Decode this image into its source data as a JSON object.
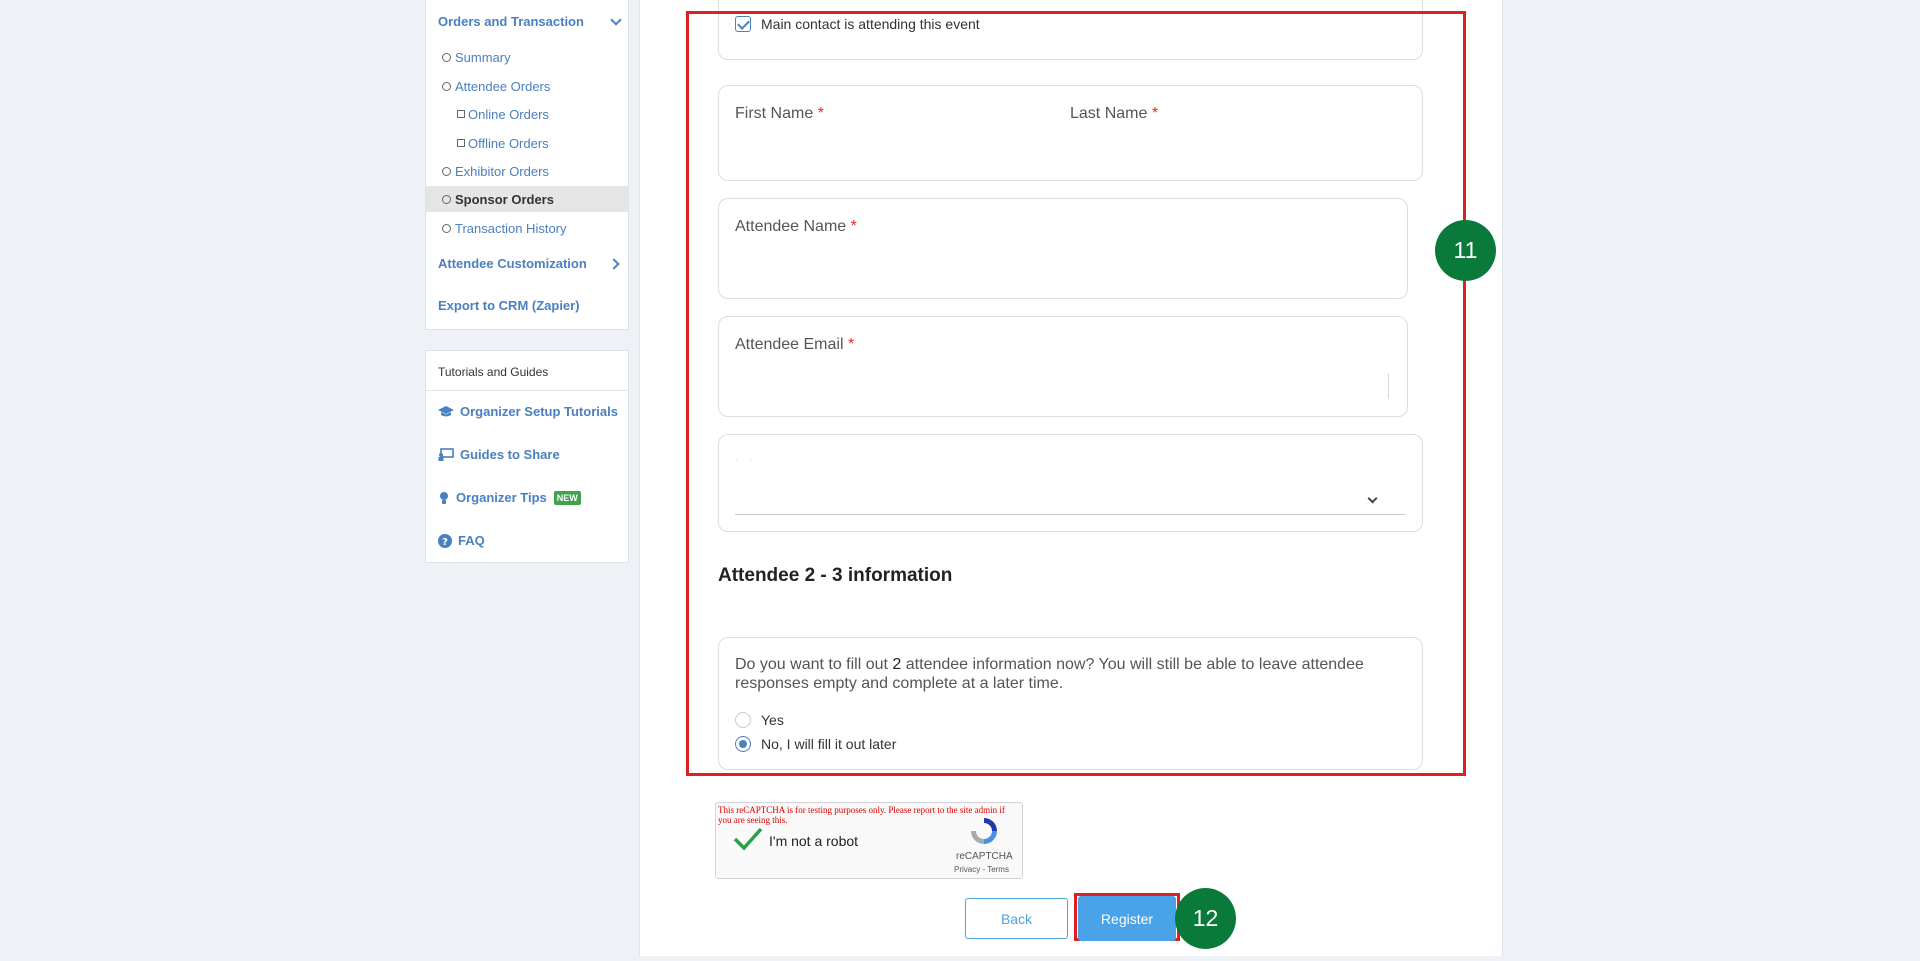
{
  "sidebar": {
    "orders_heading": "Orders and Transaction",
    "items": [
      {
        "label": "Summary"
      },
      {
        "label": "Attendee Orders"
      },
      {
        "label": "Online Orders"
      },
      {
        "label": "Offline Orders"
      },
      {
        "label": "Exhibitor Orders"
      },
      {
        "label": "Sponsor Orders"
      },
      {
        "label": "Transaction History"
      }
    ],
    "attendee_customization": "Attendee Customization",
    "export_crm": "Export to CRM (Zapier)",
    "guides": {
      "title": "Tutorials and Guides",
      "items": [
        {
          "label": "Organizer Setup Tutorials",
          "icon": "graduation-cap-icon"
        },
        {
          "label": "Guides to Share",
          "icon": "presentation-icon"
        },
        {
          "label": "Organizer Tips",
          "icon": "lightbulb-icon",
          "badge": "NEW"
        },
        {
          "label": "FAQ",
          "icon": "question-circle-icon"
        }
      ]
    }
  },
  "form": {
    "main_contact_checkbox": "Main contact is attending this event",
    "first_name": "First Name",
    "last_name": "Last Name",
    "attendee_name": "Attendee Name",
    "attendee_email": "Attendee Email",
    "required_mark": "*",
    "section_title": "Attendee 2 - 3 information",
    "question_part1": "Do you want to fill out",
    "question_number": "2",
    "question_part2": "attendee information now? You will still be able to leave attendee responses empty and complete at a later time.",
    "option_yes": "Yes",
    "option_no": "No, I will fill it out later"
  },
  "captcha": {
    "warning": "This reCAPTCHA is for testing purposes only. Please report to the site admin if you are seeing this.",
    "label": "I'm not a robot",
    "brand": "reCAPTCHA",
    "links": "Privacy - Terms"
  },
  "buttons": {
    "back": "Back",
    "register": "Register"
  },
  "markers": {
    "step11": "11",
    "step12": "12"
  },
  "colors": {
    "link_blue": "#4a7fc0",
    "highlight_red": "#e02020",
    "marker_green": "#0a7a3a",
    "register_blue": "#4aa3e8"
  }
}
